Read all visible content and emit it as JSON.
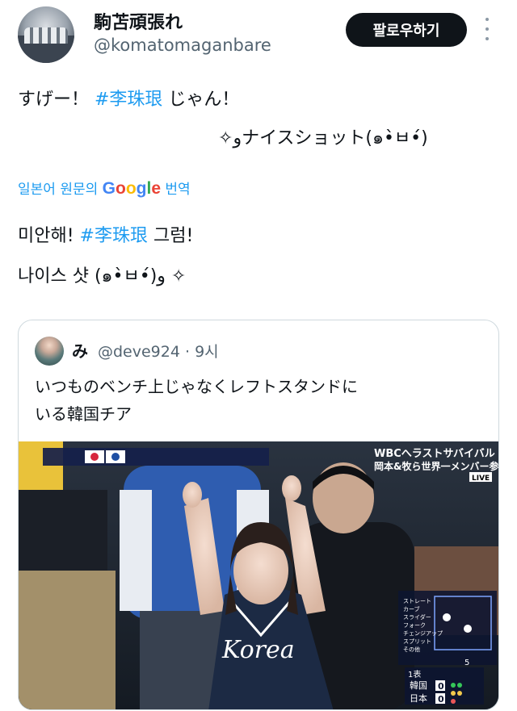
{
  "author": {
    "name": "駒苫頑張れ",
    "handle": "@komatomaganbare"
  },
  "follow_button": {
    "label": "팔로우하기"
  },
  "tweet": {
    "line1_prefix": "すげー！ ",
    "hashtag": "#李珠珢",
    "line1_suffix": " じゃん！",
    "line2": "✧ﻭナイスショット(๑•̀ㅂ•́)"
  },
  "translation": {
    "prefix": "일본어 원문의 ",
    "google_letters": [
      "G",
      "o",
      "o",
      "g",
      "l",
      "e"
    ],
    "suffix": " 번역",
    "line1_prefix": "미안해! ",
    "hashtag": "#李珠珢",
    "line1_suffix": " 그럼!",
    "line2": "나이스 샷 (๑•̀ㅂ•́)و ✧"
  },
  "quote": {
    "name": "み",
    "handle_time": "@deve924 · 9시",
    "text_line1": "いつものベンチ上じゃなくレフトスタンドに",
    "text_line2": "いる韓国チア"
  },
  "broadcast": {
    "overlay_title_line1": "WBCへ",
    "overlay_title_line1b": "ラストサバイバル",
    "overlay_title_line2": "岡本&牧ら世界一メンバー参戦",
    "live_badge": "LIVE",
    "inning": "1表",
    "team_home": "韓国",
    "team_away": "日本",
    "score_home": "0",
    "score_away": "0",
    "count": "5",
    "pitch_types": [
      "ストレート",
      "カーブ",
      "スライダー",
      "フォーク",
      "チェンジアップ",
      "スプリット",
      "その他"
    ],
    "jersey_text": "Korea",
    "colors": {
      "jersey": "#1c2a44",
      "cheer_blue": "#2f5db0",
      "yellow": "#e9c23a"
    }
  }
}
